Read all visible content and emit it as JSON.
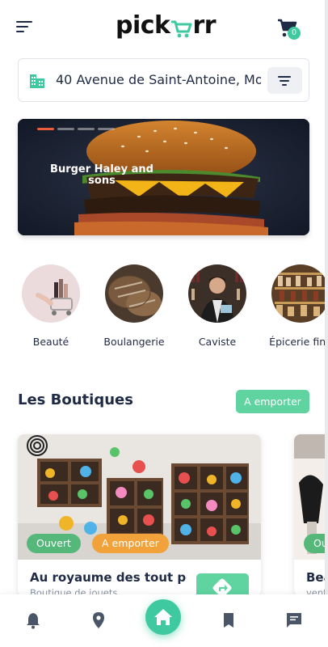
{
  "app": {
    "logo_text_start": "pick",
    "logo_text_end": "rr",
    "cart_count": "0",
    "accent_color": "#3ec9a0"
  },
  "address": {
    "value": "40 Avenue de Saint-Antoine, Mo"
  },
  "banner": {
    "title": "Burger Haley and sons",
    "slide_count": 4,
    "active_slide": 1
  },
  "categories": [
    {
      "label": "Beauté"
    },
    {
      "label": "Boulangerie"
    },
    {
      "label": "Caviste"
    },
    {
      "label": "Épicerie fine"
    }
  ],
  "section": {
    "title": "Les Boutiques",
    "filter_label": "A emporter"
  },
  "shops": [
    {
      "name": "Au royaume des tout petits",
      "type": "Boutique de jouets",
      "tags": [
        "Ouvert",
        "A emporter"
      ]
    },
    {
      "name": "Beauté",
      "type": "vente",
      "tags": [
        "Ouvert"
      ]
    }
  ],
  "nav": {
    "items": [
      "bell-icon",
      "location-pin-icon",
      "home-icon",
      "bookmark-icon",
      "chat-icon"
    ],
    "active": "home-icon"
  }
}
